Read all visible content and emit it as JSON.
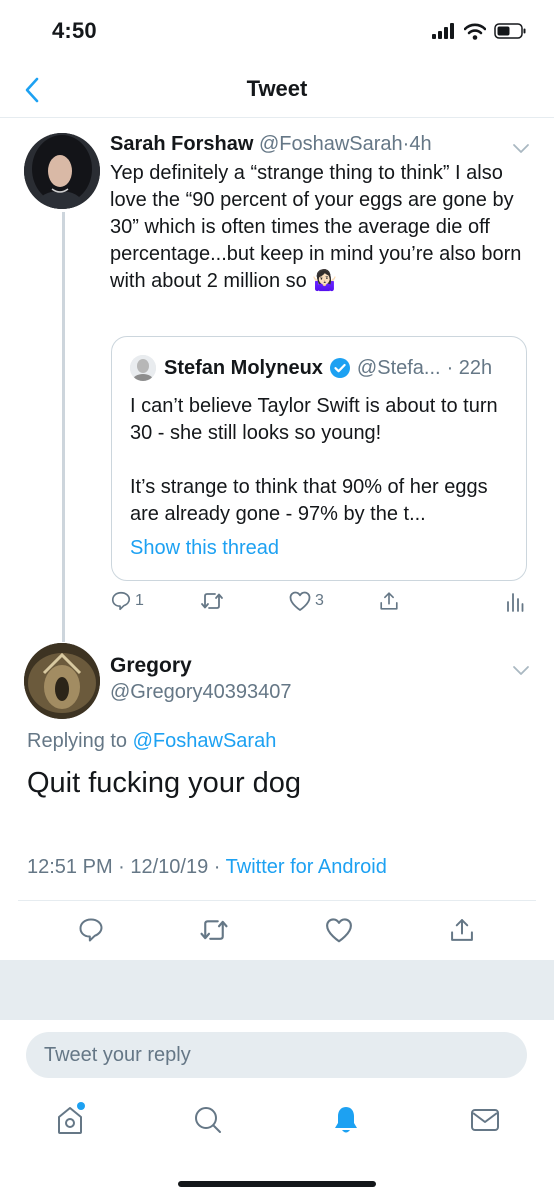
{
  "status_bar": {
    "time": "4:50"
  },
  "nav": {
    "title": "Tweet"
  },
  "tweet1": {
    "name": "Sarah Forshaw",
    "handle": "@FoshawSarah",
    "separator": "·",
    "time": "4h",
    "text": "Yep definitely a “strange thing to think” I also love the “90 percent of your eggs are gone by 30” which is often times the average die off percentage...but keep in mind you’re also born with about 2 million so",
    "emoji": "🤷🏻‍♀️",
    "quote": {
      "name": "Stefan Molyneux",
      "handle": "@Stefa...",
      "time": "· 22h",
      "line1": "I can’t believe Taylor Swift is about to turn 30 - she still looks so young!",
      "line2": "It’s strange to think that 90% of her eggs are already gone - 97% by the t...",
      "show_thread": "Show this thread"
    },
    "actions": {
      "replies": "1",
      "likes": "3"
    }
  },
  "tweet2": {
    "name": "Gregory",
    "handle": "@Gregory40393407",
    "replying_label": "Replying to ",
    "replying_handle": "@FoshawSarah",
    "text": "Quit fucking your dog",
    "timestamp": "12:51 PM · 12/10/19 · ",
    "source": "Twitter for Android"
  },
  "reply_box": {
    "placeholder": "Tweet your reply"
  },
  "tabs": [
    "home-icon",
    "search-icon",
    "notifications-icon",
    "messages-icon"
  ],
  "colors": {
    "accent": "#1da1f2",
    "muted": "#657786",
    "border": "#e6ecf0"
  }
}
